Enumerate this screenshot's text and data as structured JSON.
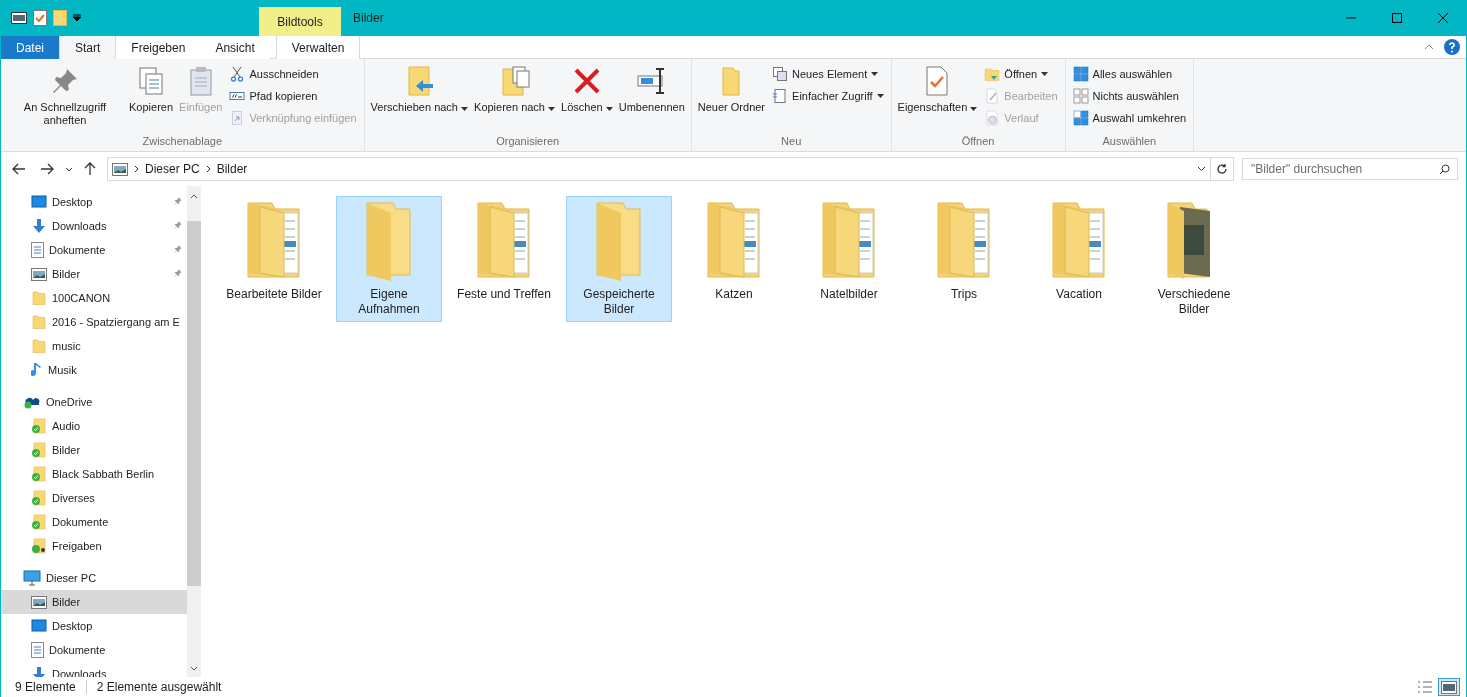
{
  "title_bar": {
    "contextual_tab": "Bildtools",
    "title": "Bilder"
  },
  "ribbon_tabs": [
    {
      "label": "Datei",
      "kind": "file",
      "selected": false
    },
    {
      "label": "Start",
      "kind": "normal",
      "selected": true
    },
    {
      "label": "Freigeben",
      "kind": "normal",
      "selected": false
    },
    {
      "label": "Ansicht",
      "kind": "normal",
      "selected": false
    },
    {
      "label": "Verwalten",
      "kind": "contextual",
      "selected": false
    }
  ],
  "ribbon_groups": [
    {
      "label": "Zwischenablage",
      "columns": [
        {
          "kind": "large",
          "items": [
            {
              "label": "An Schnellzugriff anheften",
              "kind": "pin",
              "disabled": false,
              "dropdown": false
            }
          ]
        },
        {
          "kind": "large",
          "items": [
            {
              "label": "Kopieren",
              "kind": "copy",
              "disabled": false,
              "dropdown": false
            }
          ]
        },
        {
          "kind": "large",
          "items": [
            {
              "label": "Einfügen",
              "kind": "paste",
              "disabled": true,
              "dropdown": false
            }
          ]
        },
        {
          "kind": "small",
          "items": [
            {
              "label": "Ausschneiden",
              "kind": "scissors",
              "disabled": false,
              "dropdown": false
            },
            {
              "label": "Pfad kopieren",
              "kind": "path",
              "disabled": false,
              "dropdown": false
            },
            {
              "label": "Verknüpfung einfügen",
              "kind": "shortcut",
              "disabled": true,
              "dropdown": false
            }
          ]
        }
      ]
    },
    {
      "label": "Organisieren",
      "columns": [
        {
          "kind": "large",
          "items": [
            {
              "label": "Verschieben nach",
              "kind": "move",
              "disabled": false,
              "dropdown": true
            }
          ]
        },
        {
          "kind": "large",
          "items": [
            {
              "label": "Kopieren nach",
              "kind": "copyto",
              "disabled": false,
              "dropdown": true
            }
          ]
        },
        {
          "kind": "large",
          "items": [
            {
              "label": "Löschen",
              "kind": "delete",
              "disabled": false,
              "dropdown": true
            }
          ]
        },
        {
          "kind": "large",
          "items": [
            {
              "label": "Umbenennen",
              "kind": "rename",
              "disabled": false,
              "dropdown": false
            }
          ]
        }
      ]
    },
    {
      "label": "Neu",
      "columns": [
        {
          "kind": "large",
          "items": [
            {
              "label": "Neuer Ordner",
              "kind": "folder",
              "disabled": false,
              "dropdown": false
            }
          ]
        },
        {
          "kind": "small",
          "items": [
            {
              "label": "Neues Element",
              "kind": "newitem",
              "disabled": false,
              "dropdown": true
            },
            {
              "label": "Einfacher Zugriff",
              "kind": "easy",
              "disabled": false,
              "dropdown": true
            }
          ]
        }
      ]
    },
    {
      "label": "Öffnen",
      "columns": [
        {
          "kind": "large",
          "items": [
            {
              "label": "Eigenschaften",
              "kind": "properties",
              "disabled": false,
              "dropdown": true
            }
          ]
        },
        {
          "kind": "small",
          "items": [
            {
              "label": "Öffnen",
              "kind": "open",
              "disabled": false,
              "dropdown": true
            },
            {
              "label": "Bearbeiten",
              "kind": "edit",
              "disabled": true,
              "dropdown": false
            },
            {
              "label": "Verlauf",
              "kind": "history",
              "disabled": true,
              "dropdown": false
            }
          ]
        }
      ]
    },
    {
      "label": "Auswählen",
      "columns": [
        {
          "kind": "small",
          "items": [
            {
              "label": "Alles auswählen",
              "kind": "selall",
              "disabled": false,
              "dropdown": false
            },
            {
              "label": "Nichts auswählen",
              "kind": "selnone",
              "disabled": false,
              "dropdown": false
            },
            {
              "label": "Auswahl umkehren",
              "kind": "selinv",
              "disabled": false,
              "dropdown": false
            }
          ]
        }
      ]
    }
  ],
  "address_bar": {
    "path": [
      "Dieser PC",
      "Bilder"
    ]
  },
  "search": {
    "placeholder": "\"Bilder\" durchsuchen"
  },
  "sidebar": {
    "items": [
      {
        "children": [
          {
            "label": "Desktop",
            "kind": "desktop",
            "pinned": true,
            "selected": false
          },
          {
            "label": "Downloads",
            "kind": "downloads",
            "pinned": true,
            "selected": false
          },
          {
            "label": "Dokumente",
            "kind": "documents",
            "pinned": true,
            "selected": false
          },
          {
            "label": "Bilder",
            "kind": "pictures",
            "pinned": true,
            "selected": false
          },
          {
            "label": "100CANON",
            "kind": "folder",
            "pinned": false,
            "selected": false
          },
          {
            "label": "2016 - Spatziergang am E",
            "kind": "folder",
            "pinned": false,
            "selected": false
          },
          {
            "label": "music",
            "kind": "folder",
            "pinned": false,
            "selected": false
          },
          {
            "label": "Musik",
            "kind": "music",
            "pinned": false,
            "selected": false
          }
        ]
      },
      {
        "label": "OneDrive",
        "kind": "onedrive",
        "selected": false,
        "children": [
          {
            "label": "Audio",
            "kind": "synced",
            "pinned": false,
            "selected": false
          },
          {
            "label": "Bilder",
            "kind": "synced",
            "pinned": false,
            "selected": false
          },
          {
            "label": "Black Sabbath Berlin",
            "kind": "synced",
            "pinned": false,
            "selected": false
          },
          {
            "label": "Diverses",
            "kind": "synced",
            "pinned": false,
            "selected": false
          },
          {
            "label": "Dokumente",
            "kind": "synced",
            "pinned": false,
            "selected": false
          },
          {
            "label": "Freigaben",
            "kind": "shared",
            "pinned": false,
            "selected": false
          }
        ]
      },
      {
        "label": "Dieser PC",
        "kind": "pc",
        "selected": false,
        "children": [
          {
            "label": "Bilder",
            "kind": "pictures",
            "pinned": false,
            "selected": true
          },
          {
            "label": "Desktop",
            "kind": "desktop",
            "pinned": false,
            "selected": false
          },
          {
            "label": "Dokumente",
            "kind": "documents",
            "pinned": false,
            "selected": false
          },
          {
            "label": "Downloads",
            "kind": "downloads",
            "pinned": false,
            "selected": false
          }
        ]
      }
    ]
  },
  "files": [
    {
      "name": "Bearbeitete Bilder",
      "kind": "documents",
      "selected": false
    },
    {
      "name": "Eigene Aufnahmen",
      "kind": "empty",
      "selected": true
    },
    {
      "name": "Feste und Treffen",
      "kind": "documents",
      "selected": false
    },
    {
      "name": "Gespeicherte Bilder",
      "kind": "empty",
      "selected": true
    },
    {
      "name": "Katzen",
      "kind": "documents",
      "selected": false
    },
    {
      "name": "Natelbilder",
      "kind": "documents",
      "selected": false
    },
    {
      "name": "Trips",
      "kind": "documents",
      "selected": false
    },
    {
      "name": "Vacation",
      "kind": "documents",
      "selected": false
    },
    {
      "name": "Verschiedene Bilder",
      "kind": "photo",
      "selected": false
    }
  ],
  "status_bar": {
    "count": "9 Elemente",
    "selection": "2 Elemente ausgewählt"
  },
  "view_buttons": [
    {
      "kind": "details",
      "selected": false
    },
    {
      "kind": "large-icons",
      "selected": true
    }
  ]
}
